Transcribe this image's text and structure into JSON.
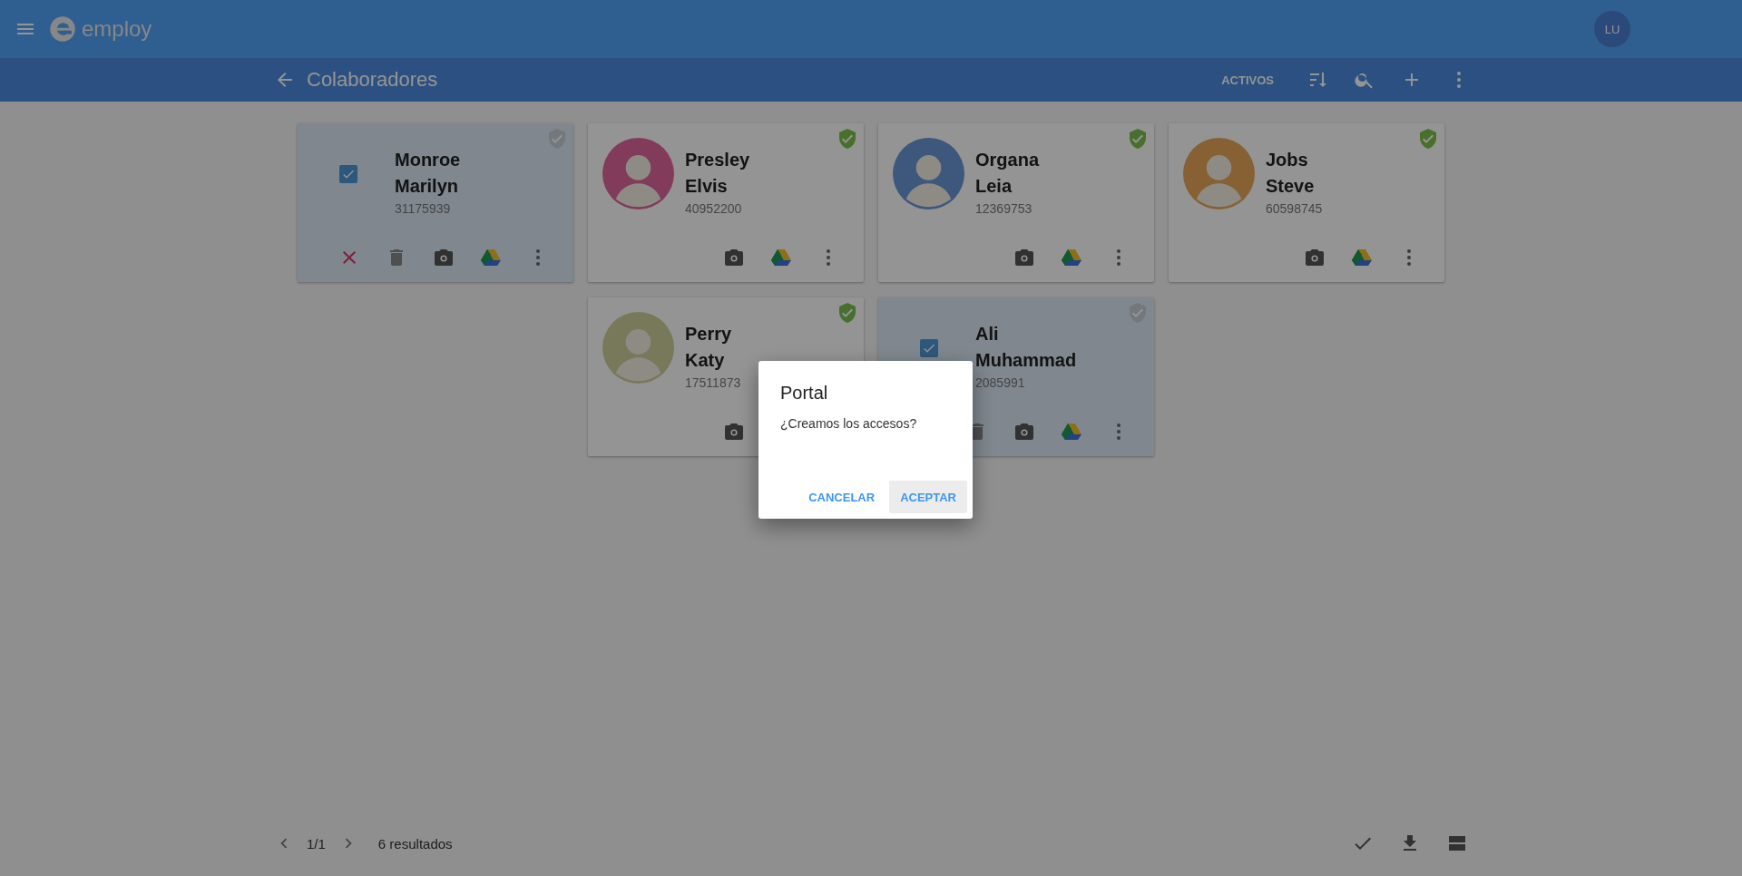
{
  "app": {
    "brand": "employ",
    "user_initials": "LU"
  },
  "toolbar": {
    "title": "Colaboradores",
    "filter": "ACTIVOS"
  },
  "cards": [
    {
      "last_name": "Monroe",
      "first_name": "Marilyn",
      "number": "31175939",
      "selected": true,
      "verified": false,
      "actions": [
        {
          "kind": "cancel"
        },
        {
          "kind": "delete"
        },
        {
          "kind": "camera"
        },
        {
          "kind": "drive"
        },
        {
          "kind": "more"
        }
      ]
    },
    {
      "last_name": "Presley",
      "first_name": "Elvis",
      "number": "40952200",
      "selected": false,
      "verified": true,
      "actions": [
        {
          "kind": "camera"
        },
        {
          "kind": "drive"
        },
        {
          "kind": "more"
        }
      ]
    },
    {
      "last_name": "Organa",
      "first_name": "Leia",
      "number": "12369753",
      "selected": false,
      "verified": true,
      "actions": [
        {
          "kind": "camera"
        },
        {
          "kind": "drive"
        },
        {
          "kind": "more"
        }
      ]
    },
    {
      "last_name": "Jobs",
      "first_name": "Steve",
      "number": "60598745",
      "selected": false,
      "verified": true,
      "actions": [
        {
          "kind": "camera"
        },
        {
          "kind": "drive"
        },
        {
          "kind": "more"
        }
      ]
    },
    {
      "last_name": "Perry",
      "first_name": "Katy",
      "number": "17511873",
      "selected": false,
      "verified": true,
      "actions": [
        {
          "kind": "camera"
        }
      ]
    },
    {
      "last_name": "Ali",
      "first_name": "Muhammad",
      "number": "2085991",
      "selected": true,
      "verified": false,
      "actions": [
        {
          "kind": "delete"
        },
        {
          "kind": "camera"
        },
        {
          "kind": "drive"
        },
        {
          "kind": "more"
        }
      ]
    }
  ],
  "pager": {
    "page": "1/1",
    "results": "6 resultados"
  },
  "dialog": {
    "title": "Portal",
    "message": "¿Creamos los accesos?",
    "buttons": [
      {
        "label": "CANCELAR",
        "focused": false
      },
      {
        "label": "ACEPTAR",
        "focused": true
      }
    ]
  }
}
